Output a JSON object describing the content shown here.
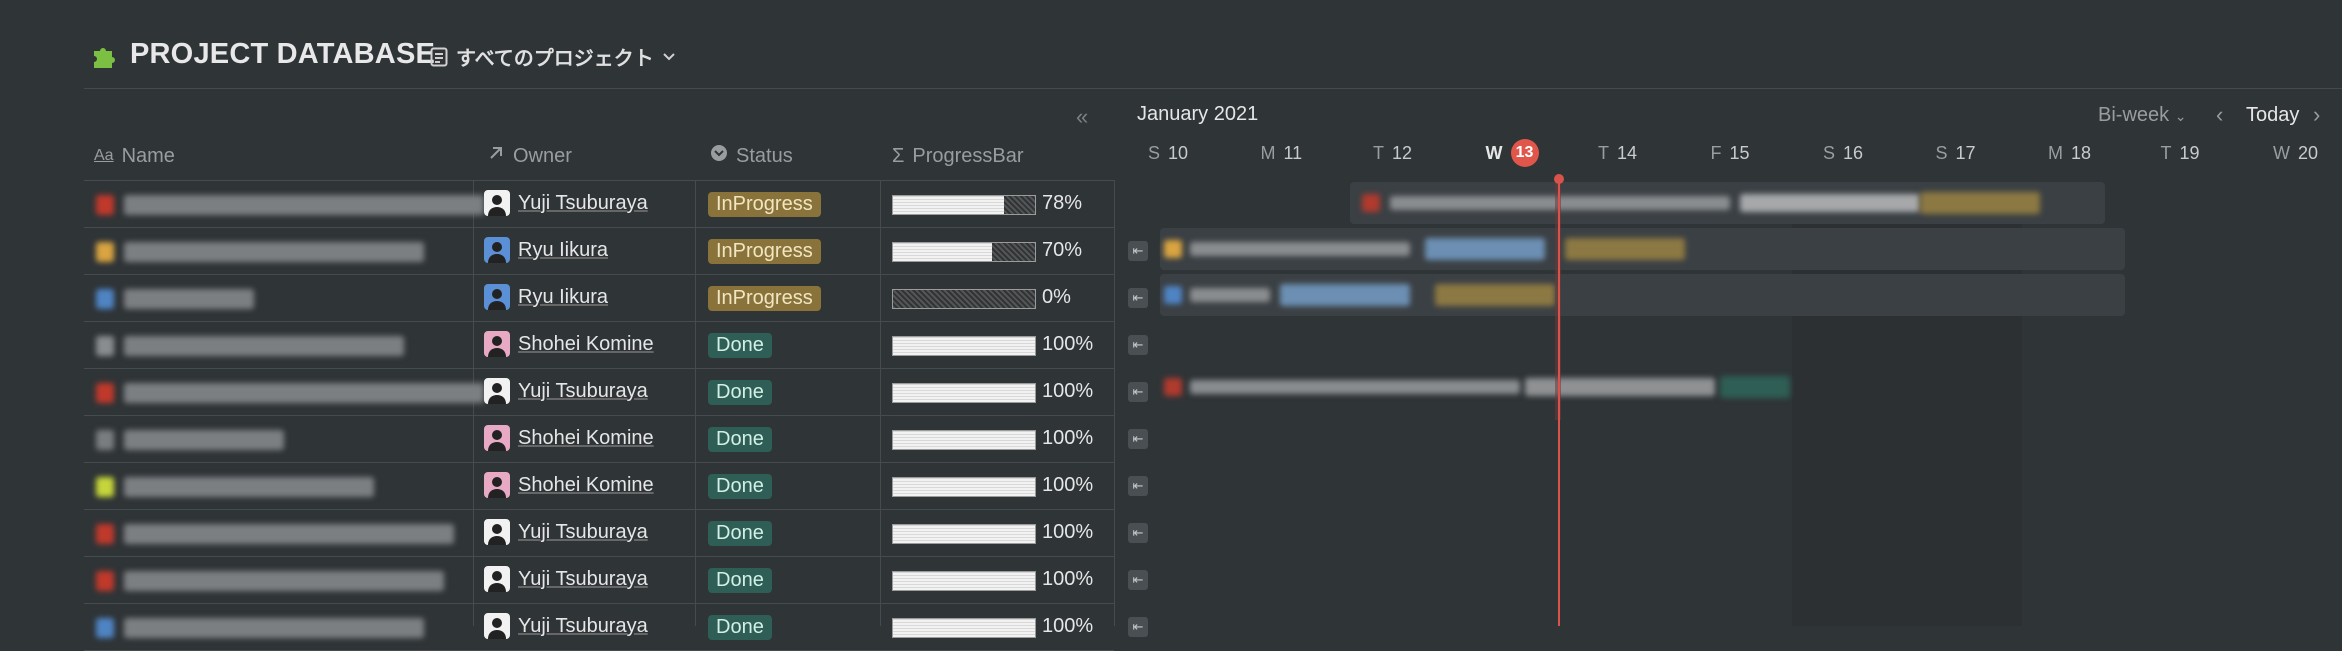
{
  "header": {
    "title": "PROJECT DATABASE",
    "view_label": "すべてのプロジェクト",
    "title_icon": "puzzle-icon"
  },
  "columns": {
    "name": "Name",
    "owner": "Owner",
    "status": "Status",
    "progress": "ProgressBar"
  },
  "rows": [
    {
      "owner": "Yuji Tsuburaya",
      "avatar": "bw",
      "status": "InProgress",
      "progress": 0.78,
      "pct": "78%"
    },
    {
      "owner": "Ryu Iikura",
      "avatar": "blue",
      "status": "InProgress",
      "progress": 0.7,
      "pct": "70%"
    },
    {
      "owner": "Ryu Iikura",
      "avatar": "blue",
      "status": "InProgress",
      "progress": 0,
      "pct": "0%"
    },
    {
      "owner": "Shohei Komine",
      "avatar": "pink",
      "status": "Done",
      "progress": 1,
      "pct": "100%"
    },
    {
      "owner": "Yuji Tsuburaya",
      "avatar": "bw",
      "status": "Done",
      "progress": 1,
      "pct": "100%"
    },
    {
      "owner": "Shohei Komine",
      "avatar": "pink",
      "status": "Done",
      "progress": 1,
      "pct": "100%"
    },
    {
      "owner": "Shohei Komine",
      "avatar": "pink",
      "status": "Done",
      "progress": 1,
      "pct": "100%"
    },
    {
      "owner": "Yuji Tsuburaya",
      "avatar": "bw",
      "status": "Done",
      "progress": 1,
      "pct": "100%"
    },
    {
      "owner": "Yuji Tsuburaya",
      "avatar": "bw",
      "status": "Done",
      "progress": 1,
      "pct": "100%"
    },
    {
      "owner": "Yuji Tsuburaya",
      "avatar": "bw",
      "status": "Done",
      "progress": 1,
      "pct": "100%"
    }
  ],
  "timeline": {
    "month": "January 2021",
    "scale": "Bi-week",
    "today_label": "Today",
    "days": [
      {
        "dow": "S",
        "num": "10"
      },
      {
        "dow": "M",
        "num": "11"
      },
      {
        "dow": "T",
        "num": "12"
      },
      {
        "dow": "W",
        "num": "13",
        "today": true
      },
      {
        "dow": "T",
        "num": "14"
      },
      {
        "dow": "F",
        "num": "15"
      },
      {
        "dow": "S",
        "num": "16"
      },
      {
        "dow": "S",
        "num": "17"
      },
      {
        "dow": "M",
        "num": "18"
      },
      {
        "dow": "T",
        "num": "19"
      },
      {
        "dow": "W",
        "num": "20"
      }
    ]
  },
  "colors": {
    "background": "#2f3437",
    "inprogress": "#89733a",
    "done": "#2e5e55",
    "today": "#e0564a"
  }
}
